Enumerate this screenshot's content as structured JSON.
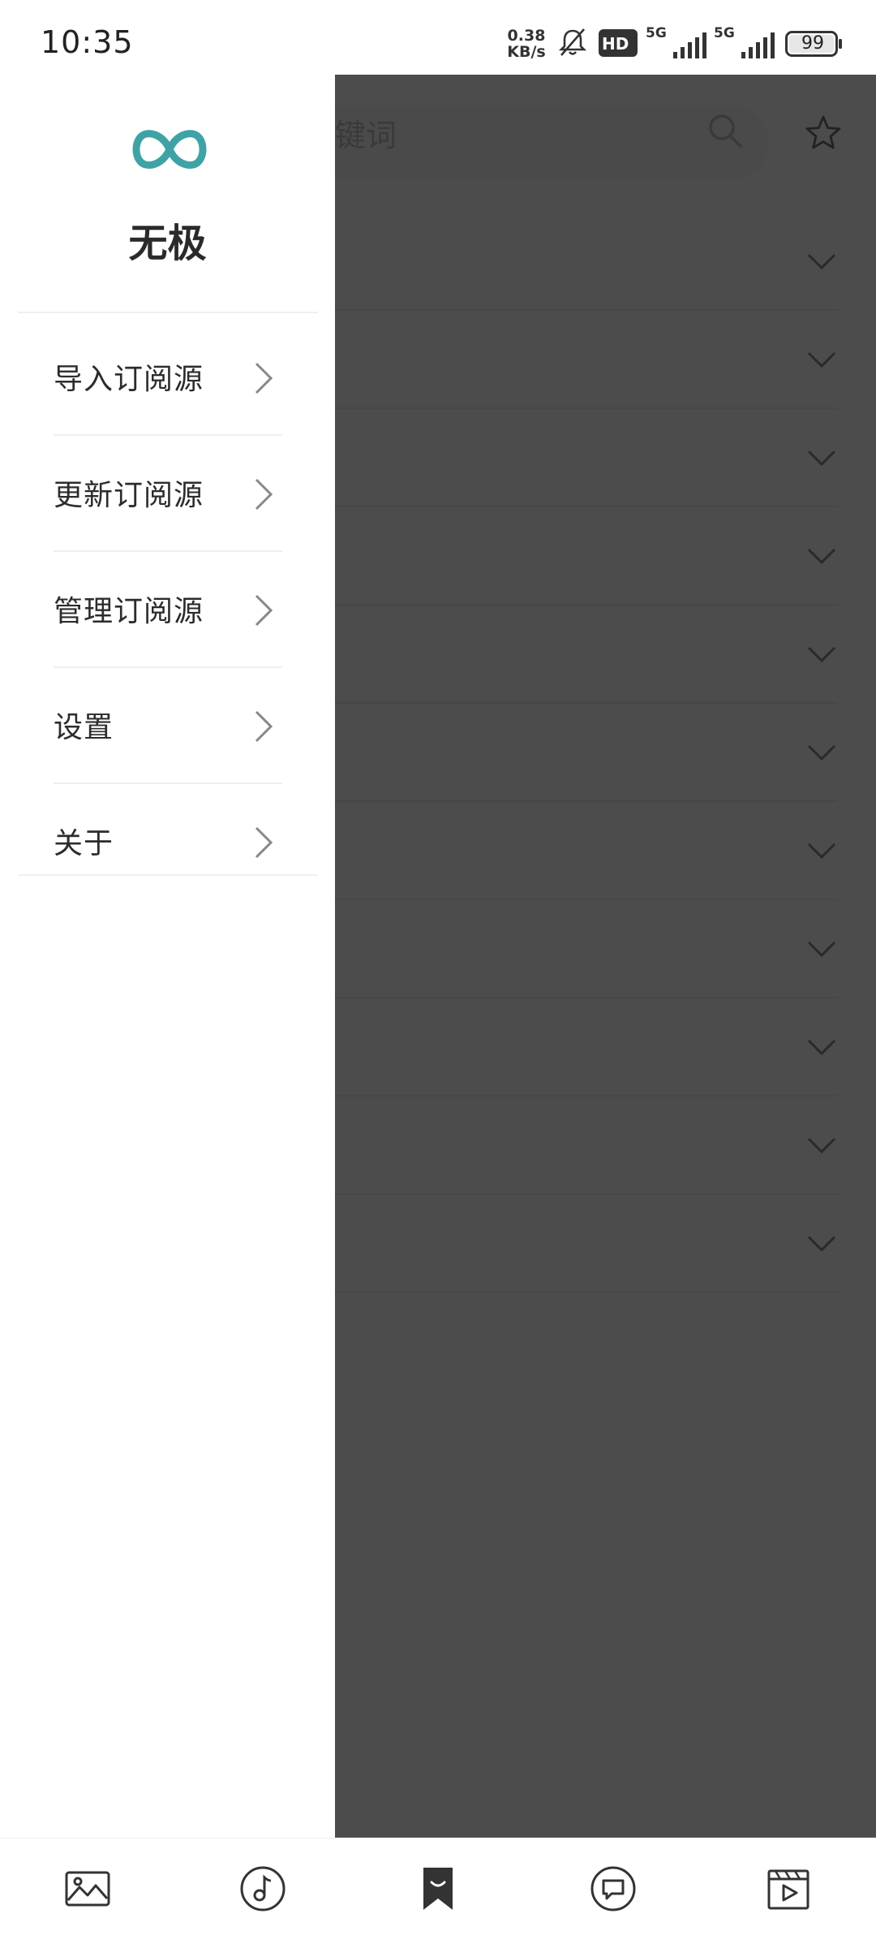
{
  "status_bar": {
    "time": "10:35",
    "net_speed_value": "0.38",
    "net_speed_unit": "KB/s",
    "hd_label": "HD",
    "signal1_label": "5G",
    "signal2_label": "5G",
    "battery_level": "99"
  },
  "background_page": {
    "search_fragment": "键词",
    "row_count": 11
  },
  "drawer": {
    "title": "无极",
    "menu": [
      {
        "label": "导入订阅源"
      },
      {
        "label": "更新订阅源"
      },
      {
        "label": "管理订阅源"
      },
      {
        "label": "设置"
      },
      {
        "label": "关于"
      }
    ]
  },
  "bottom_nav": {
    "items": [
      "image-icon",
      "music-icon",
      "bookmark-icon",
      "chat-icon",
      "video-icon"
    ],
    "active_index": 2
  },
  "colors": {
    "logo_accent": "#3fa3a6",
    "overlay": "#4c4c4c"
  }
}
